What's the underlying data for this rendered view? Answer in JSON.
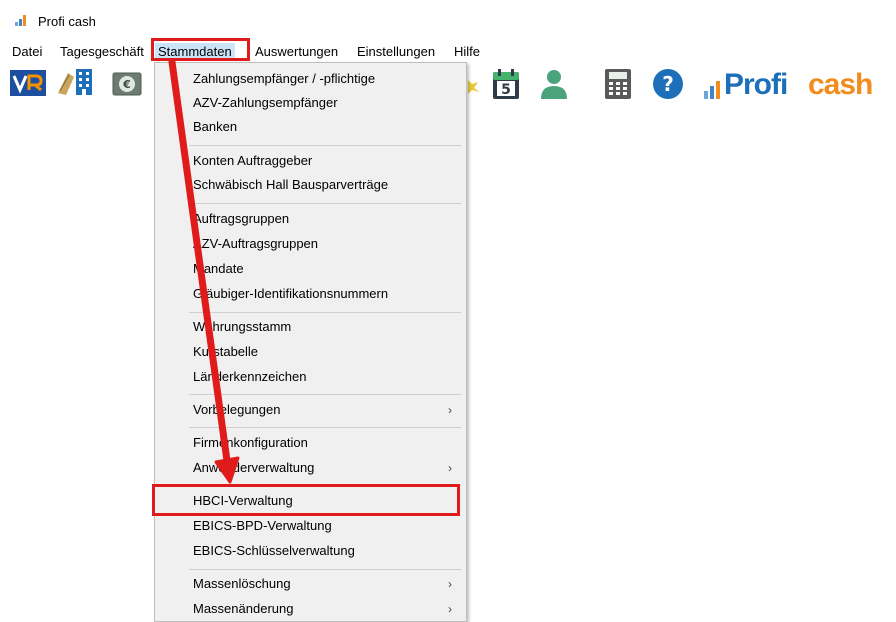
{
  "window": {
    "title": "Profi cash"
  },
  "menubar": {
    "items": [
      {
        "label": "Datei"
      },
      {
        "label": "Tagesgeschäft"
      },
      {
        "label": "Stammdaten"
      },
      {
        "label": "Auswertungen"
      },
      {
        "label": "Einstellungen"
      },
      {
        "label": "Hilfe"
      }
    ]
  },
  "toolbar": {
    "logo_text_profi": "Profi",
    "logo_text_cash": "cash",
    "calendar_day": "5",
    "help_symbol": "?",
    "euro_symbol": "€",
    "icons": [
      "vr-bank-icon",
      "building-icon",
      "euro-icon",
      "star-icon",
      "calendar-icon",
      "person-icon",
      "calculator-icon",
      "help-icon",
      "profi-cash-logo"
    ]
  },
  "dropdown": {
    "items": [
      {
        "label": "Zahlungsempfänger / -pflichtige"
      },
      {
        "label": "AZV-Zahlungsempfänger"
      },
      {
        "label": "Banken"
      },
      {
        "label": "Konten Auftraggeber"
      },
      {
        "label": "Schwäbisch Hall Bausparverträge"
      },
      {
        "label": "Auftragsgruppen"
      },
      {
        "label": "AZV-Auftragsgruppen"
      },
      {
        "label": "Mandate"
      },
      {
        "label": "Gläubiger-Identifikationsnummern"
      },
      {
        "label": "Währungsstamm"
      },
      {
        "label": "Kurstabelle"
      },
      {
        "label": "Länderkennzeichen"
      },
      {
        "label": "Vorbelegungen",
        "submenu": true
      },
      {
        "label": "Firmenkonfiguration"
      },
      {
        "label": "Anwenderverwaltung",
        "submenu": true
      },
      {
        "label": "HBCI-Verwaltung",
        "highlighted": true
      },
      {
        "label": "EBICS-BPD-Verwaltung"
      },
      {
        "label": "EBICS-Schlüsselverwaltung"
      },
      {
        "label": "Massenlöschung",
        "submenu": true
      },
      {
        "label": "Massenänderung",
        "submenu": true
      }
    ],
    "submenu_arrow": "›"
  },
  "colors": {
    "annotation_red": "#e01b1b",
    "menu_active": "#cce4f7",
    "brand_blue": "#1c6fb8",
    "brand_orange": "#f28c1e",
    "vr_orange": "#f39200",
    "person_green": "#4aa37a"
  }
}
